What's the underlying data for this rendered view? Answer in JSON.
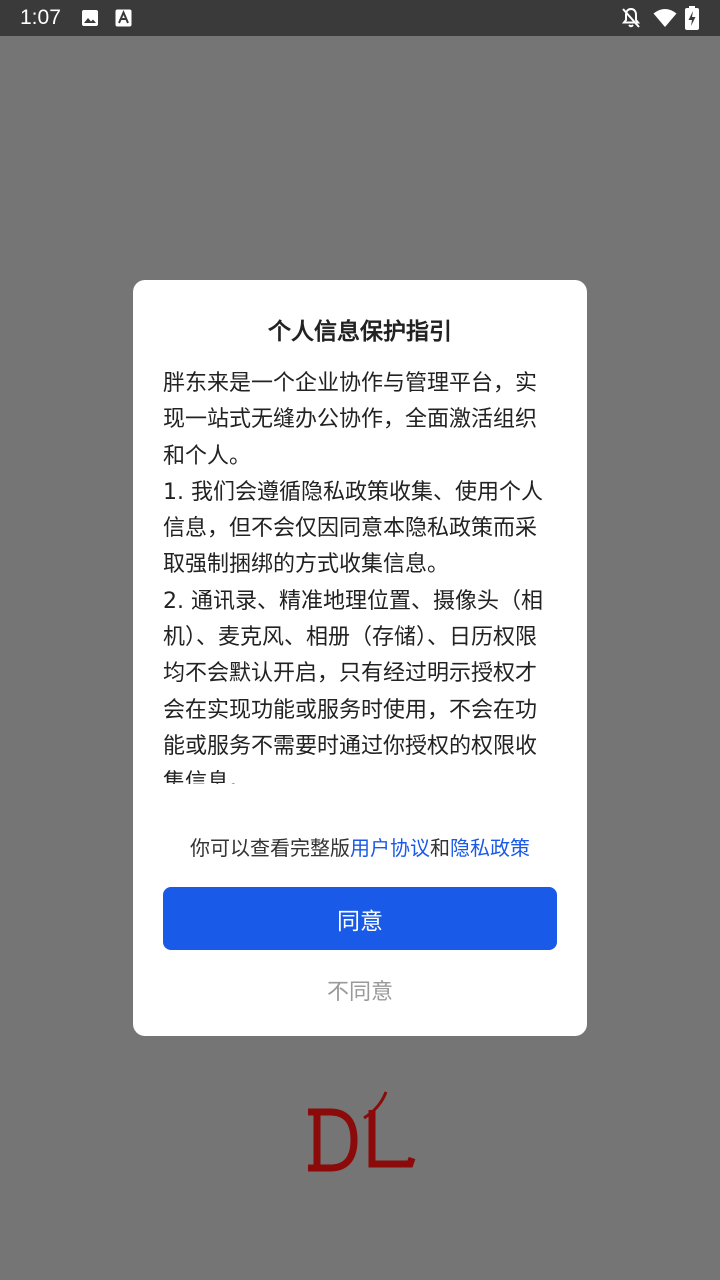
{
  "status_bar": {
    "time": "1:07",
    "icons": [
      "image-icon",
      "text-a-icon",
      "notifications-off-icon",
      "wifi-icon",
      "battery-charging-icon"
    ]
  },
  "dialog": {
    "title": "个人信息保护指引",
    "paragraphs": [
      "胖东来是一个企业协作与管理平台，实现一站式无缝办公协作，全面激活组织和个人。",
      "1. 我们会遵循隐私政策收集、使用个人信息，但不会仅因同意本隐私政策而采取强制捆绑的方式收集信息。",
      "2. 通讯录、精准地理位置、摄像头（相机）、麦克风、相册（存储）、日历权限均不会默认开启，只有经过明示授权才会在实现功能或服务时使用，不会在功能或服务不需要时通过你授权的权限收集信息。"
    ],
    "policy_prefix": "你可以查看完整版",
    "user_agreement_link": "用户协议",
    "policy_connector": "和",
    "privacy_policy_link": "隐私政策",
    "agree_label": "同意",
    "disagree_label": "不同意"
  },
  "logo": {
    "text": "DL",
    "color": "#8b0a0a"
  },
  "colors": {
    "overlay_background": "#757575",
    "status_bar": "#3a3a3a",
    "accent": "#1a5ae8",
    "dialog_background": "#ffffff"
  }
}
